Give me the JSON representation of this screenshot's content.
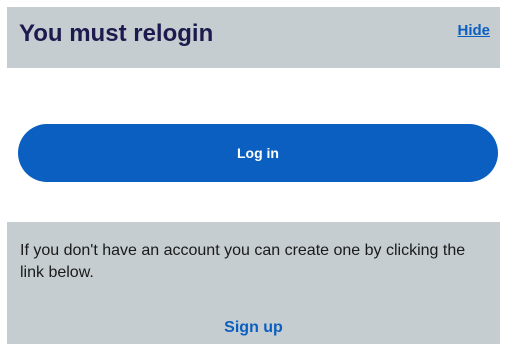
{
  "header": {
    "title": "You must relogin",
    "hide_label": "Hide"
  },
  "login": {
    "button_label": "Log in"
  },
  "signup": {
    "message": "If you don't have an account you can create one by clicking the link below.",
    "link_label": "Sign up"
  },
  "colors": {
    "panel_bg": "#c5cdd0",
    "primary": "#0a5fc0",
    "title_text": "#1f1a4e"
  }
}
